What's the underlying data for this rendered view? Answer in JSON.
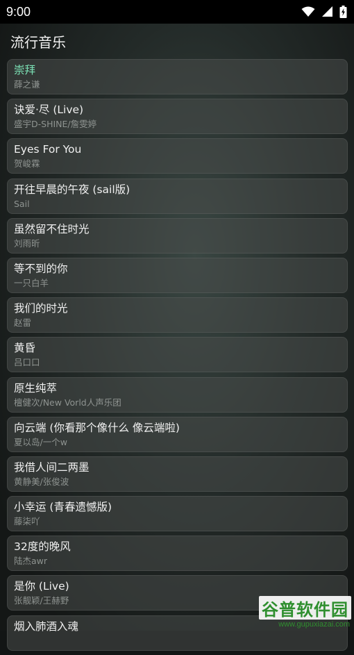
{
  "status_bar": {
    "time": "9:00",
    "icons": [
      "wifi-icon",
      "signal-icon",
      "battery-icon"
    ]
  },
  "header": {
    "title": "流行音乐"
  },
  "colors": {
    "active_song": "#7be0b4"
  },
  "songs": [
    {
      "title": "崇拜",
      "artist": "薛之谦",
      "active": true
    },
    {
      "title": "诀爱·尽 (Live)",
      "artist": "盛宇D-SHINE/詹雯婷"
    },
    {
      "title": "Eyes For You",
      "artist": "贺峻霖"
    },
    {
      "title": "开往早晨的午夜 (sail版)",
      "artist": "Sail"
    },
    {
      "title": "虽然留不住时光",
      "artist": "刘雨昕"
    },
    {
      "title": "等不到的你",
      "artist": "一只白羊"
    },
    {
      "title": "我们的时光",
      "artist": "赵雷"
    },
    {
      "title": "黄昏",
      "artist": "吕口口"
    },
    {
      "title": "原生纯萃",
      "artist": "檀健次/New Vorld人声乐团"
    },
    {
      "title": "向云端 (你看那个像什么 像云端啦)",
      "artist": "夏以岛/一个w"
    },
    {
      "title": "我借人间二两墨",
      "artist": "黄静美/张俊波"
    },
    {
      "title": "小幸运 (青春遗憾版)",
      "artist": "藤柒吖"
    },
    {
      "title": "32度的晚风",
      "artist": "陆杰awr"
    },
    {
      "title": "是你 (Live)",
      "artist": "张靓颖/王赫野"
    },
    {
      "title": "烟入肺酒入魂",
      "artist": ""
    }
  ],
  "watermark": {
    "text": "谷普软件园",
    "url": "www.gupuxiazai.com"
  }
}
